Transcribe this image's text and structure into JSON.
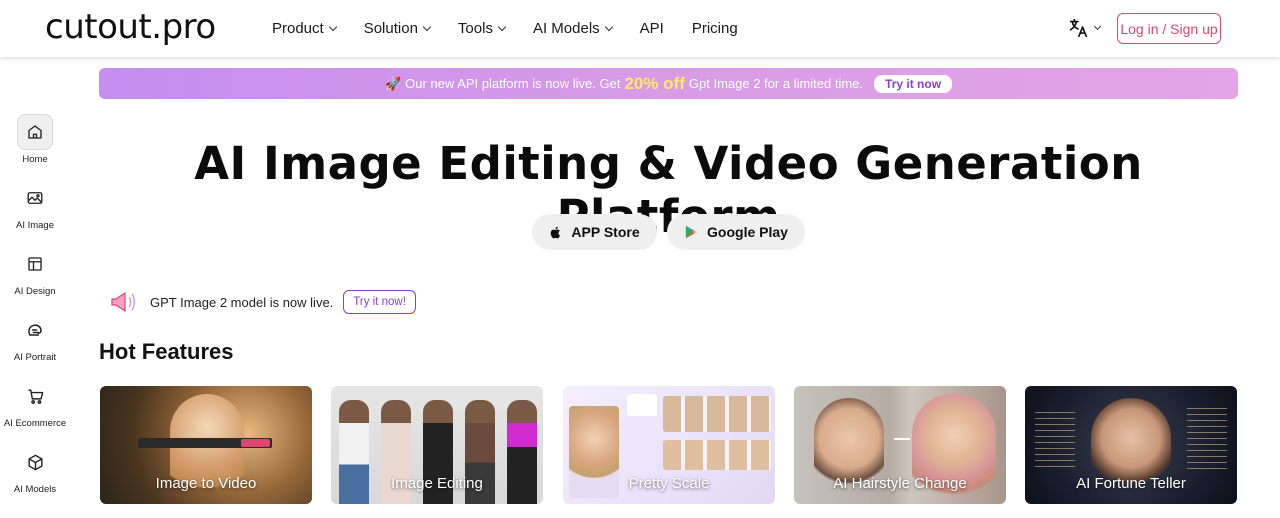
{
  "header": {
    "logo": "cutout.pro",
    "nav": [
      {
        "label": "Product",
        "dropdown": true
      },
      {
        "label": "Solution",
        "dropdown": true
      },
      {
        "label": "Tools",
        "dropdown": true
      },
      {
        "label": "AI Models",
        "dropdown": true
      },
      {
        "label": "API",
        "dropdown": false
      },
      {
        "label": "Pricing",
        "dropdown": false
      }
    ],
    "language_icon": "translate-icon",
    "login_label": "Log in / Sign up"
  },
  "promo": {
    "text_before": "Our new API platform is now live. Get",
    "highlight": "20% off",
    "text_after": "Gpt Image 2 for a limited time.",
    "button": "Try it now"
  },
  "sidebar": {
    "items": [
      {
        "label": "Home",
        "icon": "home-icon",
        "active": true
      },
      {
        "label": "AI Image",
        "icon": "image-icon",
        "active": false
      },
      {
        "label": "AI Design",
        "icon": "layout-icon",
        "active": false
      },
      {
        "label": "AI Portrait",
        "icon": "portrait-icon",
        "active": false
      },
      {
        "label": "AI Ecommerce",
        "icon": "cart-icon",
        "active": false
      },
      {
        "label": "AI Models",
        "icon": "cube-icon",
        "active": false
      }
    ]
  },
  "hero": {
    "title": "AI Image Editing & Video Generation Platform",
    "app_store": "APP Store",
    "google_play": "Google Play"
  },
  "notice": {
    "text": "GPT Image 2 model is now live.",
    "button": "Try it now!"
  },
  "features": {
    "title": "Hot Features",
    "cards": [
      {
        "label": "Image to Video"
      },
      {
        "label": "Image Editing"
      },
      {
        "label": "Pretty Scale"
      },
      {
        "label": "AI Hairstyle Change"
      },
      {
        "label": "AI Fortune Teller"
      }
    ]
  },
  "colors": {
    "accent_pink": "#e0456f",
    "accent_purple": "#8a3fd1",
    "promo_highlight": "#ffe96b"
  }
}
